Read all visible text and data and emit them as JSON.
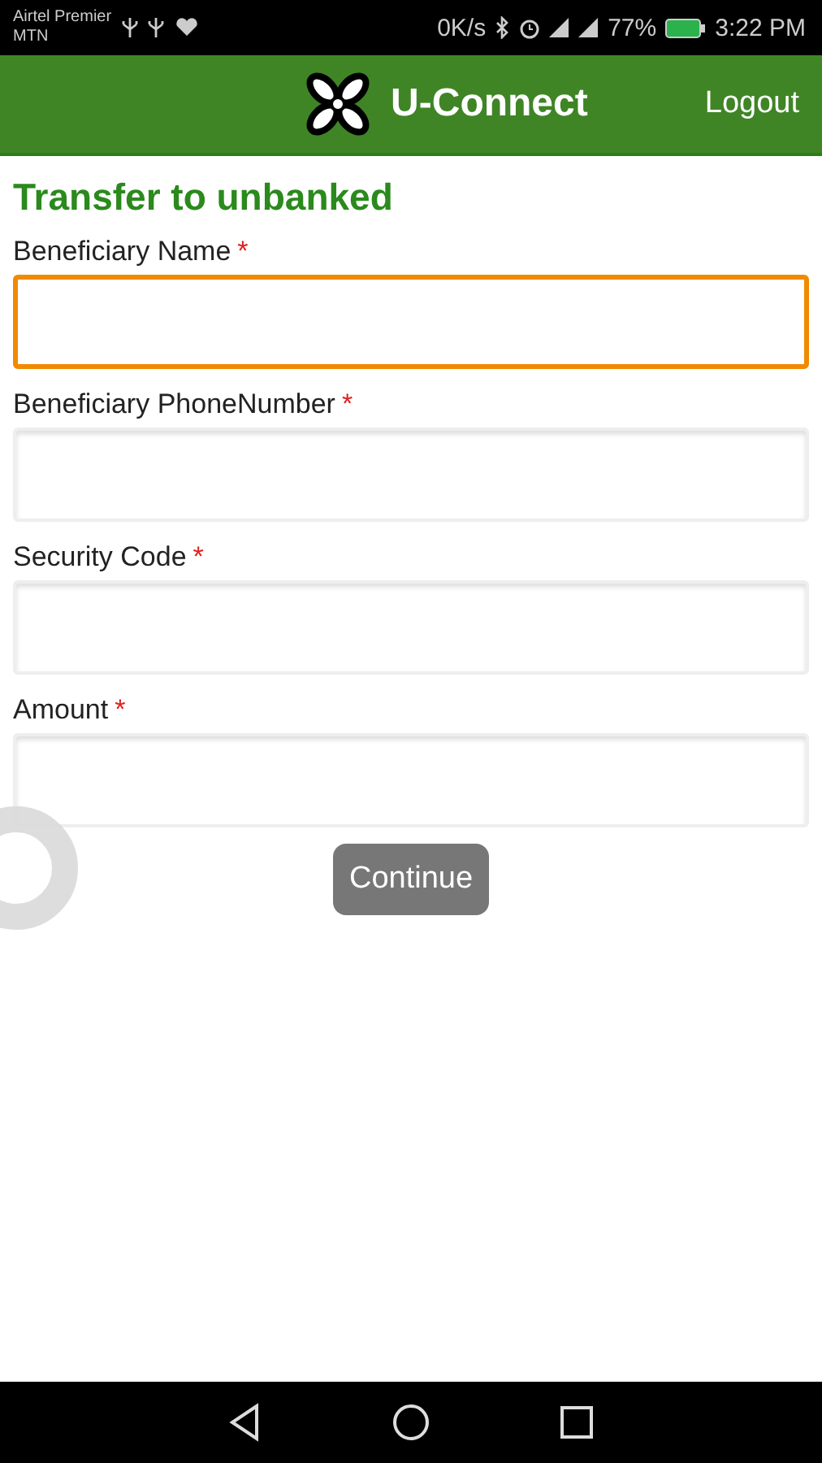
{
  "status_bar": {
    "carrier_1": "Airtel Premier",
    "carrier_2": "MTN",
    "speed": "0K/s",
    "battery": "77%",
    "time": "3:22 PM"
  },
  "header": {
    "title": "U-Connect",
    "logout": "Logout"
  },
  "form": {
    "title": "Transfer to unbanked",
    "fields": [
      {
        "label": "Beneficiary Name",
        "required_mark": "*",
        "focused": true
      },
      {
        "label": "Beneficiary PhoneNumber",
        "required_mark": "*",
        "focused": false
      },
      {
        "label": "Security Code",
        "required_mark": "*",
        "focused": false
      },
      {
        "label": "Amount",
        "required_mark": "*",
        "focused": false
      }
    ],
    "button": "Continue"
  }
}
